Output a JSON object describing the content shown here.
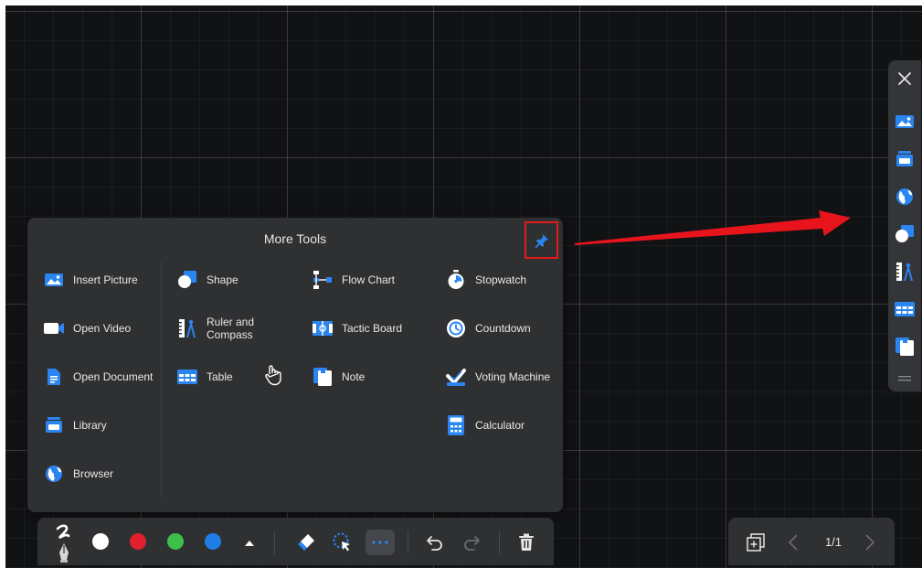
{
  "panel": {
    "title": "More Tools",
    "tools": [
      {
        "id": "insert-picture",
        "label": "Insert Picture",
        "icon": "picture-icon"
      },
      {
        "id": "open-video",
        "label": "Open Video",
        "icon": "video-icon"
      },
      {
        "id": "open-document",
        "label": "Open Document",
        "icon": "document-icon"
      },
      {
        "id": "library",
        "label": "Library",
        "icon": "library-icon"
      },
      {
        "id": "browser",
        "label": "Browser",
        "icon": "globe-icon"
      },
      {
        "id": "shape",
        "label": "Shape",
        "icon": "shape-icon"
      },
      {
        "id": "ruler-compass",
        "label": "Ruler and\nCompass",
        "icon": "ruler-compass-icon"
      },
      {
        "id": "table",
        "label": "Table",
        "icon": "table-icon"
      },
      {
        "id": "flow-chart",
        "label": "Flow Chart",
        "icon": "flowchart-icon"
      },
      {
        "id": "tactic-board",
        "label": "Tactic Board",
        "icon": "tactic-board-icon"
      },
      {
        "id": "note",
        "label": "Note",
        "icon": "note-icon"
      },
      {
        "id": "stopwatch",
        "label": "Stopwatch",
        "icon": "stopwatch-icon"
      },
      {
        "id": "countdown",
        "label": "Countdown",
        "icon": "countdown-icon"
      },
      {
        "id": "voting-machine",
        "label": "Voting Machine",
        "icon": "voting-icon"
      },
      {
        "id": "calculator",
        "label": "Calculator",
        "icon": "calculator-icon"
      }
    ]
  },
  "sidebar": {
    "items": [
      "close-icon",
      "picture-icon",
      "library-icon",
      "globe-icon",
      "shape-icon",
      "ruler-compass-icon",
      "table-icon",
      "note-icon",
      "drag-handle-icon"
    ]
  },
  "toolbar": {
    "colors": [
      "#ffffff",
      "#e0202e",
      "#3cc04a",
      "#1f7ee6"
    ]
  },
  "pager": {
    "page": "1/1"
  },
  "colors": {
    "accent": "#2b85f0",
    "highlight": "#e01b1b"
  }
}
